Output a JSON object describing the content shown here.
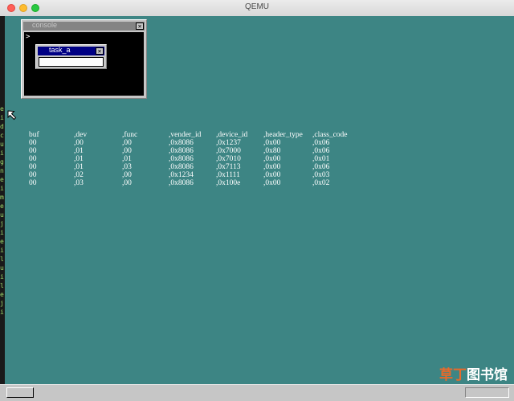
{
  "window": {
    "title": "QEMU"
  },
  "console_window": {
    "title": "console",
    "close": "✕",
    "prompt": ">"
  },
  "task_window": {
    "title": "task_a",
    "close": "✕"
  },
  "left_strip": {
    "glyphs": "e\ni\nd\nc\nu\ni\ng\nn\ne\ni\nm\ne\nu\nj\ni\ne\ni\nl\nu\ni\nl\ne\nj\ni"
  },
  "pci_table": {
    "columns": [
      "buf",
      ",dev",
      ",func",
      ",vender_id",
      ",device_id",
      ",header_type",
      ",class_code"
    ],
    "rows": [
      [
        "00",
        ",00",
        ",00",
        ",0x8086",
        ",0x1237",
        ",0x00",
        ",0x06"
      ],
      [
        "00",
        ",01",
        ",00",
        ",0x8086",
        ",0x7000",
        ",0x80",
        ",0x06"
      ],
      [
        "00",
        ",01",
        ",01",
        ",0x8086",
        ",0x7010",
        ",0x00",
        ",0x01"
      ],
      [
        "00",
        ",01",
        ",03",
        ",0x8086",
        ",0x7113",
        ",0x00",
        ",0x06"
      ],
      [
        "00",
        ",02",
        ",00",
        ",0x1234",
        ",0x1111",
        ",0x00",
        ",0x03"
      ],
      [
        "00",
        ",03",
        ",00",
        ",0x8086",
        ",0x100e",
        ",0x00",
        ",0x02"
      ]
    ]
  },
  "watermark": {
    "part1": "草丁",
    "part2": "图书馆"
  },
  "colors": {
    "desktop": "#3d8584",
    "active_title": "#000084",
    "inactive_title": "#848484"
  }
}
